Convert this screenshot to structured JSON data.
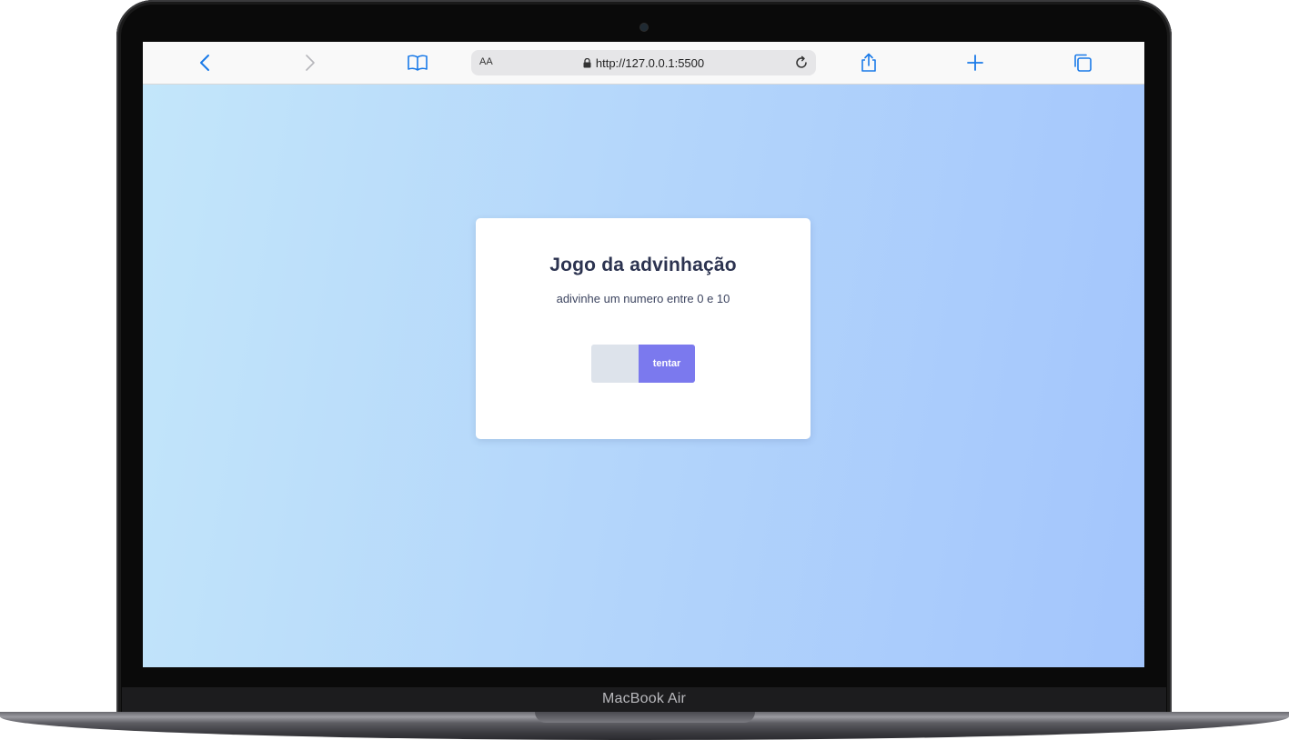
{
  "device": {
    "label": "MacBook Air"
  },
  "browser": {
    "text_size_label": "AA",
    "url": "http://127.0.0.1:5500",
    "accent_color": "#1a7ae8"
  },
  "page": {
    "title": "Jogo da advinhação",
    "subtitle": "adivinhe um numero entre 0 e 10",
    "guess_input": {
      "value": "",
      "placeholder": ""
    },
    "submit_label": "tentar",
    "colors": {
      "button": "#7b79ee",
      "input": "#dde3eb",
      "title": "#2c3350",
      "background_start": "#c3e6fa",
      "background_end": "#a3c5fc"
    }
  }
}
